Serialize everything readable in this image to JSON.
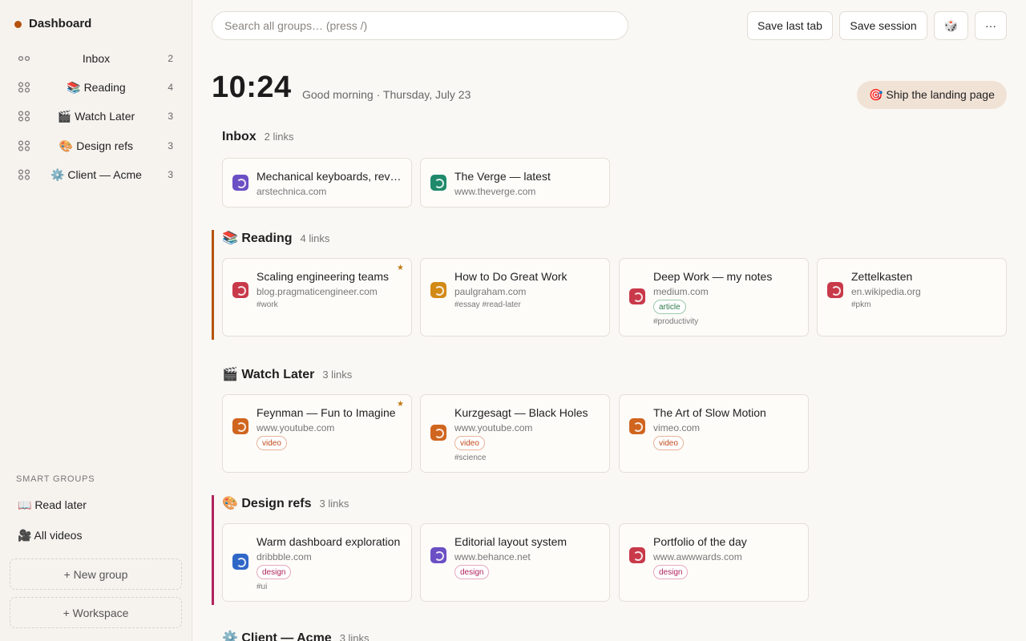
{
  "sidebar": {
    "brand": "Dashboard",
    "items": [
      {
        "label": "Inbox",
        "count": "2"
      },
      {
        "label": "📚 Reading",
        "count": "4"
      },
      {
        "label": "🎬 Watch Later",
        "count": "3"
      },
      {
        "label": "🎨 Design refs",
        "count": "3"
      },
      {
        "label": "⚙️ Client — Acme",
        "count": "3"
      }
    ],
    "smart_title": "SMART GROUPS",
    "smart_items": [
      "📖 Read later",
      "🎥 All videos"
    ],
    "new_group": "+ New group",
    "workspace": "+ Workspace"
  },
  "topbar": {
    "search_placeholder": "Search all groups…  (press /)",
    "save_last_tab": "Save last tab",
    "save_session": "Save session",
    "dice_icon": "🎲",
    "more_icon": "···"
  },
  "header": {
    "time": "10:24",
    "greeting": "Good morning · Thursday, July 23",
    "goal": "🎯 Ship the landing page"
  },
  "colors": {
    "brand_dot": "#b5530f",
    "reading_accent": "#b5530f",
    "design_accent": "#b0245c"
  },
  "groups": [
    {
      "title": "Inbox",
      "count": "2 links",
      "cards": [
        {
          "title": "Mechanical keyboards, revisited",
          "domain": "arstechnica.com",
          "favicon_color": "#6b4fc4"
        },
        {
          "title": "The Verge — latest",
          "domain": "www.theverge.com",
          "favicon_color": "#1f8a6b"
        }
      ]
    },
    {
      "title": "📚 Reading",
      "count": "4 links",
      "cards": [
        {
          "title": "Scaling engineering teams",
          "domain": "blog.pragmaticengineer.com",
          "hashtags": "#work",
          "starred": "★",
          "favicon_color": "#c8394a"
        },
        {
          "title": "How to Do Great Work",
          "domain": "paulgraham.com",
          "hashtags": "#essay  #read-later",
          "favicon_color": "#d28a16"
        },
        {
          "title": "Deep Work — my notes",
          "domain": "medium.com",
          "tag": "article",
          "hashtags": "#productivity",
          "favicon_color": "#c8394a"
        },
        {
          "title": "Zettelkasten",
          "domain": "en.wikipedia.org",
          "hashtags": "#pkm",
          "favicon_color": "#c8394a"
        }
      ]
    },
    {
      "title": "🎬 Watch Later",
      "count": "3 links",
      "cards": [
        {
          "title": "Feynman — Fun to Imagine",
          "domain": "www.youtube.com",
          "tag": "video",
          "starred": "★",
          "favicon_color": "#d0651f"
        },
        {
          "title": "Kurzgesagt — Black Holes",
          "domain": "www.youtube.com",
          "tag": "video",
          "hashtags": "#science",
          "favicon_color": "#d0651f"
        },
        {
          "title": "The Art of Slow Motion",
          "domain": "vimeo.com",
          "tag": "video",
          "favicon_color": "#d0651f"
        }
      ]
    },
    {
      "title": "🎨 Design refs",
      "count": "3 links",
      "cards": [
        {
          "title": "Warm dashboard exploration",
          "domain": "dribbble.com",
          "tag": "design",
          "hashtags": "#ui",
          "favicon_color": "#2f67c7"
        },
        {
          "title": "Editorial layout system",
          "domain": "www.behance.net",
          "tag": "design",
          "favicon_color": "#6b4fc4"
        },
        {
          "title": "Portfolio of the day",
          "domain": "www.awwwards.com",
          "tag": "design",
          "favicon_color": "#c8394a"
        }
      ]
    },
    {
      "title": "⚙️ Client — Acme",
      "count": "3 links",
      "cards": []
    }
  ],
  "tag_styles": {
    "article": {
      "color": "#2f7a4a",
      "border": "#9bcaa9"
    },
    "video": {
      "color": "#c0491b",
      "border": "#e8b39a"
    },
    "design": {
      "color": "#b0245c",
      "border": "#e6a9c0"
    }
  }
}
